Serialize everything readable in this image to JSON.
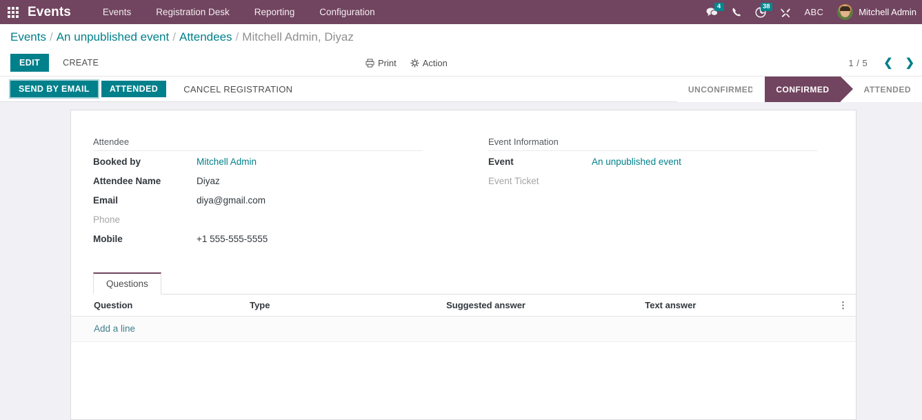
{
  "navbar": {
    "apps_icon": "apps-grid-icon",
    "brand": "Events",
    "menu": [
      {
        "label": "Events"
      },
      {
        "label": "Registration Desk"
      },
      {
        "label": "Reporting"
      },
      {
        "label": "Configuration"
      }
    ],
    "systray": {
      "messages_icon": "messages-icon",
      "messages_count": "4",
      "phone_icon": "phone-icon",
      "activities_icon": "activity-clock-icon",
      "activities_count": "38",
      "tools_icon": "tools-icon",
      "debug_label": "ABC",
      "avatar_icon": "user-avatar",
      "username": "Mitchell Admin"
    },
    "bg_color": "#71445f"
  },
  "breadcrumb": {
    "items": [
      {
        "label": "Events",
        "active": false
      },
      {
        "label": "An unpublished event",
        "active": false
      },
      {
        "label": "Attendees",
        "active": false
      },
      {
        "label": "Mitchell Admin, Diyaz",
        "active": true
      }
    ],
    "separator": "/"
  },
  "control_panel": {
    "edit_label": "EDIT",
    "create_label": "CREATE",
    "print_label": "Print",
    "print_icon": "printer-icon",
    "action_label": "Action",
    "action_icon": "gear-icon",
    "pager_value": "1 / 5",
    "prev_icon": "chevron-left-icon",
    "next_icon": "chevron-right-icon"
  },
  "statusbar": {
    "buttons": [
      {
        "label": "SEND BY EMAIL",
        "style": "primary"
      },
      {
        "label": "ATTENDED",
        "style": "secondary"
      },
      {
        "label": "CANCEL REGISTRATION",
        "style": "plain"
      }
    ],
    "stages": [
      {
        "label": "UNCONFIRMED",
        "active": false
      },
      {
        "label": "CONFIRMED",
        "active": true
      },
      {
        "label": "ATTENDED",
        "active": false
      }
    ],
    "active_color": "#71445f"
  },
  "form": {
    "left_group": {
      "title": "Attendee",
      "fields": [
        {
          "label": "Booked by",
          "value": "Mitchell Admin",
          "link": true,
          "empty": false
        },
        {
          "label": "Attendee Name",
          "value": "Diyaz",
          "link": false,
          "empty": false
        },
        {
          "label": "Email",
          "value": "diya@gmail.com",
          "link": false,
          "empty": false
        },
        {
          "label": "Phone",
          "value": "",
          "link": false,
          "empty": true
        },
        {
          "label": "Mobile",
          "value": "+1 555-555-5555",
          "link": false,
          "empty": false
        }
      ]
    },
    "right_group": {
      "title": "Event Information",
      "fields": [
        {
          "label": "Event",
          "value": "An unpublished event",
          "link": true,
          "empty": false
        },
        {
          "label": "Event Ticket",
          "value": "",
          "link": false,
          "empty": true
        }
      ]
    }
  },
  "notebook": {
    "tabs": [
      {
        "label": "Questions",
        "active": true
      }
    ],
    "table": {
      "columns": [
        "Question",
        "Type",
        "Suggested answer",
        "Text answer"
      ],
      "rows": [],
      "optional_columns_icon": "vertical-dots-icon",
      "add_line_label": "Add a line"
    }
  }
}
